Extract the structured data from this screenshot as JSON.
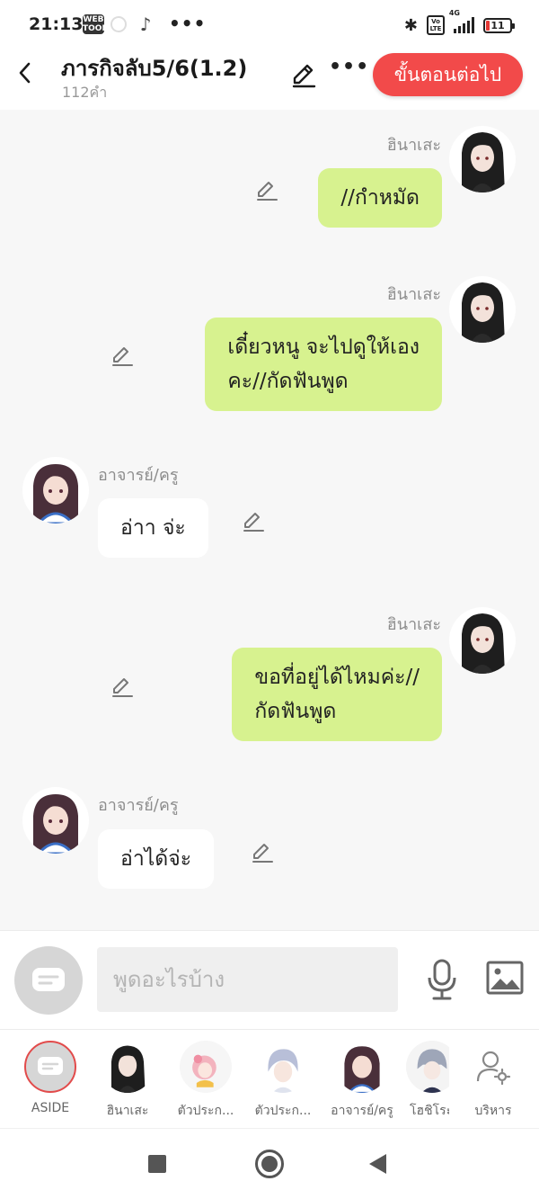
{
  "status_bar": {
    "time": "21:13",
    "webtoon_label": "WEB TOON",
    "network": "4G",
    "volte": "Vo LTE",
    "battery": "11"
  },
  "header": {
    "title": "ภารกิจลับ5/6(1.2)",
    "word_count": "112คำ",
    "next_button": "ขั้นตอนต่อไป"
  },
  "messages": [
    {
      "speaker": "ฮินาเสะ",
      "side": "right",
      "lines": [
        "//กำหมัด"
      ]
    },
    {
      "speaker": "ฮินาเสะ",
      "side": "right",
      "lines": [
        "เดี๋ยวหนู จะไปดูให้เอง",
        "คะ//กัดฟันพูด"
      ]
    },
    {
      "speaker": "อาจารย์/ครู",
      "side": "left",
      "lines": [
        "อ่าา จ่ะ"
      ]
    },
    {
      "speaker": "ฮินาเสะ",
      "side": "right",
      "lines": [
        "ขอที่อยู่ได้ไหมค่ะ//",
        "กัดฟันพูด"
      ]
    },
    {
      "speaker": "อาจารย์/ครู",
      "side": "left",
      "lines": [
        "อ่าได้จ่ะ"
      ]
    }
  ],
  "input": {
    "placeholder": "พูดอะไรบ้าง"
  },
  "characters": [
    {
      "label": "ASIDE"
    },
    {
      "label": "ฮินาเสะ"
    },
    {
      "label": "ตัวประก..."
    },
    {
      "label": "ตัวประก..."
    },
    {
      "label": "อาจารย์/ครู"
    },
    {
      "label": "โฮชิโระ"
    },
    {
      "label": "บริหาร"
    }
  ],
  "colors": {
    "accent": "#f24a4a",
    "my_bubble": "#d7f28f",
    "their_bubble": "#ffffff",
    "chat_bg": "#f7f7f7"
  }
}
